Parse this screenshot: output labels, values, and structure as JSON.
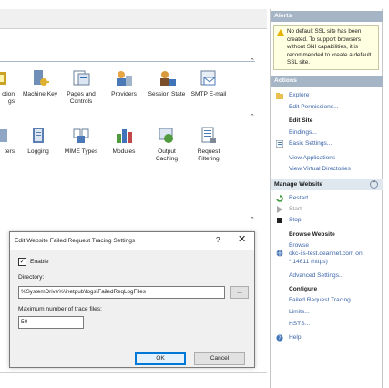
{
  "features": {
    "row1": [
      {
        "label": "ction\ngs",
        "icon": "authorization-icon"
      },
      {
        "label": "Machine Key",
        "icon": "machine-key-icon"
      },
      {
        "label": "Pages and\nControls",
        "icon": "pages-controls-icon"
      },
      {
        "label": "Providers",
        "icon": "providers-icon"
      },
      {
        "label": "Session State",
        "icon": "session-state-icon"
      },
      {
        "label": "SMTP E-mail",
        "icon": "smtp-email-icon"
      }
    ],
    "row2": [
      {
        "label": "ters",
        "icon": "filters-icon"
      },
      {
        "label": "Logging",
        "icon": "logging-icon"
      },
      {
        "label": "MIME Types",
        "icon": "mime-types-icon"
      },
      {
        "label": "Modules",
        "icon": "modules-icon"
      },
      {
        "label": "Output\nCaching",
        "icon": "output-caching-icon"
      },
      {
        "label": "Request\nFiltering",
        "icon": "request-filtering-icon"
      }
    ]
  },
  "dialog": {
    "title": "Edit Website Failed Request Tracing Settings",
    "help": "?",
    "close": "✕",
    "enable_label": "Enable",
    "enable_check": "✓",
    "directory_label": "Directory:",
    "directory_value": "%SystemDrive%\\inetpub\\logs\\FailedReqLogFiles",
    "browse_label": "...",
    "max_label": "Maximum number of trace files:",
    "max_value": "50",
    "ok_label": "OK",
    "cancel_label": "Cancel"
  },
  "alerts": {
    "header": "Alerts",
    "message": "No default SSL site has been created. To support browsers without SNI capabilities, it is recommended to create a default SSL site."
  },
  "actions": {
    "header": "Actions",
    "explore": "Explore",
    "edit_permissions": "Edit Permissions...",
    "edit_site": "Edit Site",
    "bindings": "Bindings...",
    "basic_settings": "Basic Settings...",
    "view_applications": "View Applications",
    "view_virtual_directories": "View Virtual Directories",
    "manage_website": "Manage Website",
    "restart": "Restart",
    "start": "Start",
    "stop": "Stop",
    "browse_website": "Browse Website",
    "browse": "Browse",
    "browse_url_1": "okc-iis-test.deannet.com on",
    "browse_url_2": "*:14611 (https)",
    "advanced_settings": "Advanced Settings...",
    "configure": "Configure",
    "failed_request_tracing": "Failed Request Tracing...",
    "limits": "Limits...",
    "hsts": "HSTS...",
    "help": "Help"
  },
  "colors": {
    "link": "#3b64a8",
    "section_header": "#a6b5c6",
    "sub_header": "#dfe7ef",
    "alert_bg": "#ffffe1",
    "focus_blue": "#0078d7"
  }
}
